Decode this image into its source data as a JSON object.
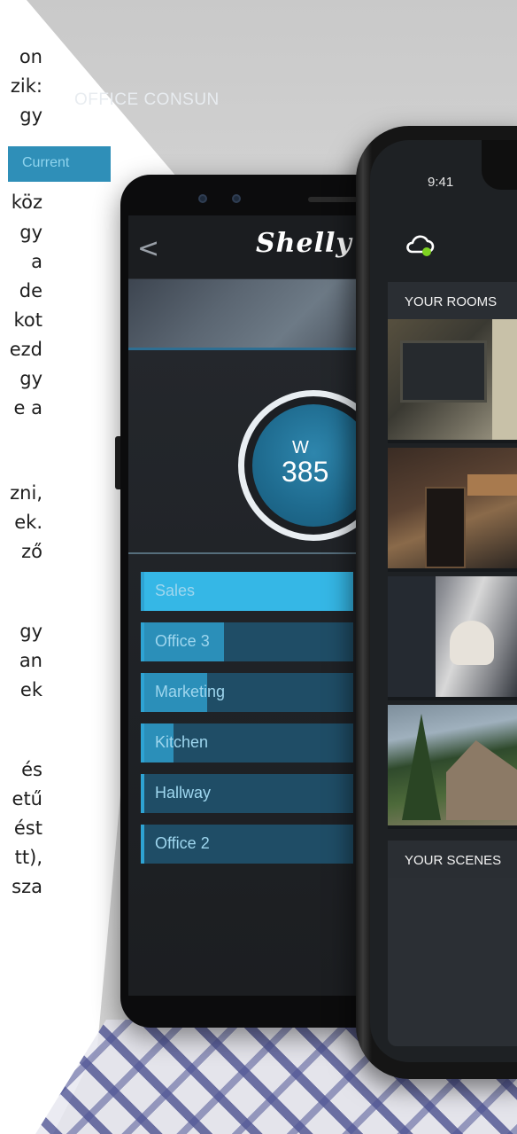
{
  "article_fragments": [
    "on",
    "zik:",
    "gy",
    "köz",
    "gy",
    "a",
    "de",
    "kot",
    "ezd",
    "gy",
    "e a",
    "zni,",
    "ek.",
    "ző",
    "gy",
    "an",
    "ek",
    "és",
    "etű",
    "ést",
    "tt),",
    "sza"
  ],
  "back_phone": {
    "brand": "Shelly",
    "office_title": "OFFICE CONSUN",
    "current_tab": "Current",
    "gauge": {
      "unit": "W",
      "value": "385"
    },
    "rooms": [
      {
        "name": "Sales",
        "level": 1.0
      },
      {
        "name": "Office 3",
        "level": 0.38
      },
      {
        "name": "Marketing",
        "level": 0.3
      },
      {
        "name": "Kitchen",
        "level": 0.14
      },
      {
        "name": "Hallway",
        "level": 0.0
      },
      {
        "name": "Office 2",
        "level": 0.0
      }
    ]
  },
  "front_phone": {
    "time": "9:41",
    "rooms_title": "YOUR ROOMS",
    "scenes_title": "YOUR SCENES"
  },
  "colors": {
    "accent": "#2ea3d3",
    "bar_fill": "#2b8fb9",
    "cloud_status": "#7ed321"
  },
  "icons": [
    "back-chevron-icon",
    "cloud-icon"
  ]
}
